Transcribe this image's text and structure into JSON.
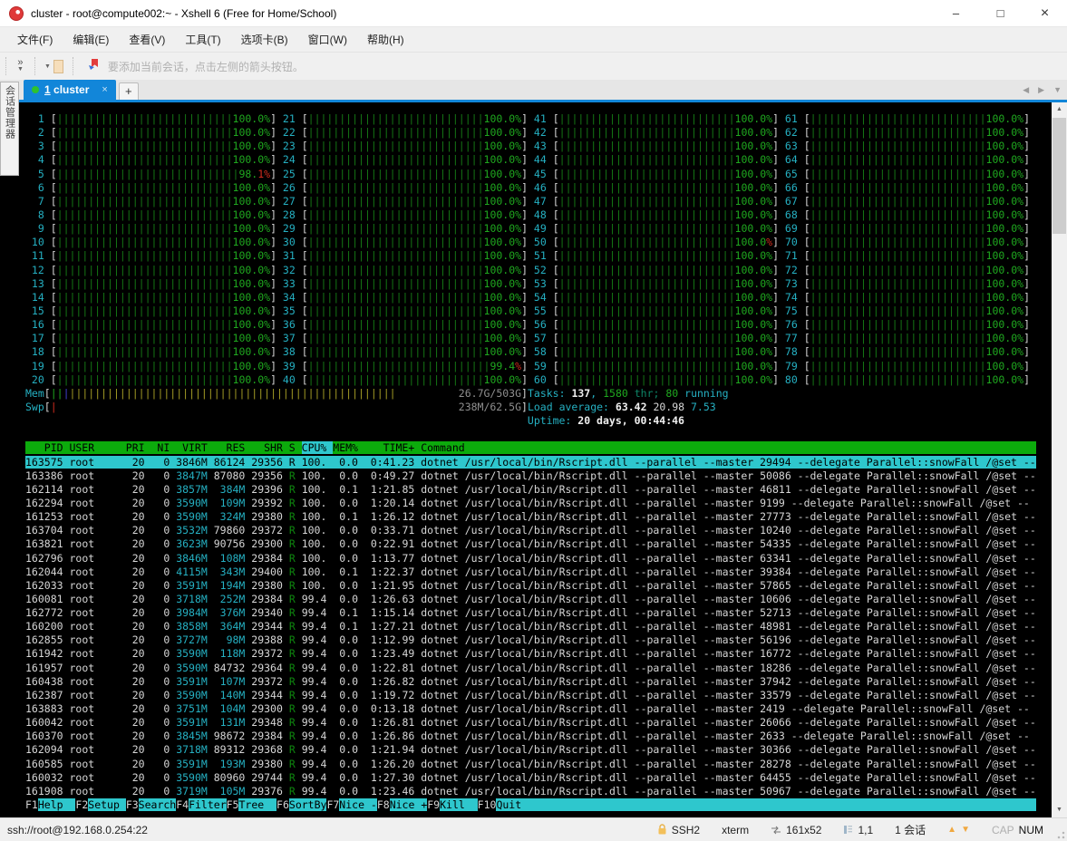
{
  "window": {
    "title": "cluster - root@compute002:~ - Xshell 6 (Free for Home/School)",
    "menu": [
      "文件(F)",
      "编辑(E)",
      "查看(V)",
      "工具(T)",
      "选项卡(B)",
      "窗口(W)",
      "帮助(H)"
    ],
    "toolbar_hint": "要添加当前会话，点击左侧的箭头按钮。",
    "tab": {
      "index": "1",
      "label": "cluster",
      "close": "×",
      "add": "+"
    },
    "side_tab": "会话管理器",
    "controls": {
      "minimize": "–",
      "maximize": "□",
      "close": "×"
    },
    "statusbar": {
      "url": "ssh://root@192.168.0.254:22",
      "protocol": "SSH2",
      "term_type": "xterm",
      "size": "161x52",
      "cursor": "1,1",
      "sessions": "1 会话",
      "cap": "CAP",
      "num": "NUM"
    }
  },
  "htop": {
    "cpus": [
      "100.0%",
      "100.0%",
      "100.0%",
      "100.0%",
      {
        "m": "98.",
        "r": "1%"
      },
      "100.0%",
      "100.0%",
      "100.0%",
      "100.0%",
      "100.0%",
      "100.0%",
      "100.0%",
      "100.0%",
      "100.0%",
      "100.0%",
      "100.0%",
      "100.0%",
      "100.0%",
      "100.0%",
      "100.0%",
      "100.0%",
      "100.0%",
      "100.0%",
      "100.0%",
      "100.0%",
      "100.0%",
      "100.0%",
      "100.0%",
      "100.0%",
      "100.0%",
      "100.0%",
      "100.0%",
      "100.0%",
      "100.0%",
      "100.0%",
      "100.0%",
      "100.0%",
      "100.0%",
      {
        "m": "99.4",
        "r": "%"
      },
      "100.0%",
      "100.0%",
      "100.0%",
      "100.0%",
      "100.0%",
      "100.0%",
      "100.0%",
      "100.0%",
      "100.0%",
      "100.0%",
      {
        "m": "100.0",
        "r": "%"
      },
      "100.0%",
      "100.0%",
      "100.0%",
      "100.0%",
      "100.0%",
      "100.0%",
      "100.0%",
      "100.0%",
      "100.0%",
      "100.0%",
      "100.0%",
      "100.0%",
      "100.0%",
      "100.0%",
      "100.0%",
      "100.0%",
      "100.0%",
      "100.0%",
      "100.0%",
      "100.0%",
      "100.0%",
      "100.0%",
      "100.0%",
      "100.0%",
      "100.0%",
      "100.0%",
      "100.0%",
      "100.0%",
      "100.0%",
      "100.0%"
    ],
    "mem": {
      "label": "Mem",
      "value": "26.7G/503G"
    },
    "swp": {
      "label": "Swp",
      "value": "238M/62.5G"
    },
    "tasks_line": [
      [
        "Tasks: ",
        "cy"
      ],
      [
        "137",
        "whb"
      ],
      [
        ", ",
        "cy"
      ],
      [
        "1580",
        "gr"
      ],
      [
        " thr",
        "thr"
      ],
      [
        "; ",
        "thr"
      ],
      [
        "80",
        "gr"
      ],
      [
        " running",
        "cy"
      ]
    ],
    "load_line": [
      [
        "Load average: ",
        "cy"
      ],
      [
        "63.42 ",
        "whb"
      ],
      [
        "20.98 ",
        "wh"
      ],
      [
        "7.53",
        "cy"
      ]
    ],
    "uptime_line": [
      [
        "Uptime: ",
        "cy"
      ],
      [
        "20 days, 00:44:46",
        "whb"
      ]
    ],
    "columns": [
      "PID",
      "USER",
      "PRI",
      "NI",
      "VIRT",
      "RES",
      "SHR",
      "S",
      "CPU%",
      "MEM%",
      "TIME+",
      "Command"
    ],
    "sort_column": "CPU%",
    "processes": [
      {
        "sel": true,
        "pid": "163575",
        "user": "root",
        "pri": "20",
        "ni": "0",
        "virt": "3846M",
        "res": "86124",
        "shr": "29356",
        "s": "R",
        "cpu": "100.",
        "mem": "0.0",
        "time": "0:41.23",
        "cmd": "dotnet /usr/local/bin/Rscript.dll --parallel --master 29494 --delegate Parallel::snowFall /@set --"
      },
      {
        "pid": "163386",
        "user": "root",
        "pri": "20",
        "ni": "0",
        "virt": "3847M",
        "res": "87080",
        "shr": "29356",
        "s": "R",
        "cpu": "100.",
        "mem": "0.0",
        "time": "0:49.27",
        "cmd": "dotnet /usr/local/bin/Rscript.dll --parallel --master 50086 --delegate Parallel::snowFall /@set --"
      },
      {
        "pid": "162114",
        "user": "root",
        "pri": "20",
        "ni": "0",
        "virt": "3857M",
        "res": "384M",
        "shr": "29396",
        "s": "R",
        "cpu": "100.",
        "mem": "0.1",
        "time": "1:21.85",
        "cmd": "dotnet /usr/local/bin/Rscript.dll --parallel --master 46811 --delegate Parallel::snowFall /@set --"
      },
      {
        "pid": "162294",
        "user": "root",
        "pri": "20",
        "ni": "0",
        "virt": "3590M",
        "res": "109M",
        "shr": "29392",
        "s": "R",
        "cpu": "100.",
        "mem": "0.0",
        "time": "1:20.14",
        "cmd": "dotnet /usr/local/bin/Rscript.dll --parallel --master 9199 --delegate Parallel::snowFall /@set --"
      },
      {
        "pid": "161253",
        "user": "root",
        "pri": "20",
        "ni": "0",
        "virt": "3590M",
        "res": "324M",
        "shr": "29380",
        "s": "R",
        "cpu": "100.",
        "mem": "0.1",
        "time": "1:26.12",
        "cmd": "dotnet /usr/local/bin/Rscript.dll --parallel --master 27773 --delegate Parallel::snowFall /@set --"
      },
      {
        "pid": "163704",
        "user": "root",
        "pri": "20",
        "ni": "0",
        "virt": "3532M",
        "res": "79860",
        "shr": "29372",
        "s": "R",
        "cpu": "100.",
        "mem": "0.0",
        "time": "0:33.71",
        "cmd": "dotnet /usr/local/bin/Rscript.dll --parallel --master 10240 --delegate Parallel::snowFall /@set --"
      },
      {
        "pid": "163821",
        "user": "root",
        "pri": "20",
        "ni": "0",
        "virt": "3623M",
        "res": "90756",
        "shr": "29300",
        "s": "R",
        "cpu": "100.",
        "mem": "0.0",
        "time": "0:22.91",
        "cmd": "dotnet /usr/local/bin/Rscript.dll --parallel --master 54335 --delegate Parallel::snowFall /@set --"
      },
      {
        "pid": "162796",
        "user": "root",
        "pri": "20",
        "ni": "0",
        "virt": "3846M",
        "res": "108M",
        "shr": "29384",
        "s": "R",
        "cpu": "100.",
        "mem": "0.0",
        "time": "1:13.77",
        "cmd": "dotnet /usr/local/bin/Rscript.dll --parallel --master 63341 --delegate Parallel::snowFall /@set --"
      },
      {
        "pid": "162044",
        "user": "root",
        "pri": "20",
        "ni": "0",
        "virt": "4115M",
        "res": "343M",
        "shr": "29400",
        "s": "R",
        "cpu": "100.",
        "mem": "0.1",
        "time": "1:22.37",
        "cmd": "dotnet /usr/local/bin/Rscript.dll --parallel --master 39384 --delegate Parallel::snowFall /@set --"
      },
      {
        "pid": "162033",
        "user": "root",
        "pri": "20",
        "ni": "0",
        "virt": "3591M",
        "res": "194M",
        "shr": "29380",
        "s": "R",
        "cpu": "100.",
        "mem": "0.0",
        "time": "1:21.95",
        "cmd": "dotnet /usr/local/bin/Rscript.dll --parallel --master 57865 --delegate Parallel::snowFall /@set --"
      },
      {
        "pid": "160081",
        "user": "root",
        "pri": "20",
        "ni": "0",
        "virt": "3718M",
        "res": "252M",
        "shr": "29384",
        "s": "R",
        "cpu": "99.4",
        "mem": "0.0",
        "time": "1:26.63",
        "cmd": "dotnet /usr/local/bin/Rscript.dll --parallel --master 10606 --delegate Parallel::snowFall /@set --"
      },
      {
        "pid": "162772",
        "user": "root",
        "pri": "20",
        "ni": "0",
        "virt": "3984M",
        "res": "376M",
        "shr": "29340",
        "s": "R",
        "cpu": "99.4",
        "mem": "0.1",
        "time": "1:15.14",
        "cmd": "dotnet /usr/local/bin/Rscript.dll --parallel --master 52713 --delegate Parallel::snowFall /@set --"
      },
      {
        "pid": "160200",
        "user": "root",
        "pri": "20",
        "ni": "0",
        "virt": "3858M",
        "res": "364M",
        "shr": "29344",
        "s": "R",
        "cpu": "99.4",
        "mem": "0.1",
        "time": "1:27.21",
        "cmd": "dotnet /usr/local/bin/Rscript.dll --parallel --master 48981 --delegate Parallel::snowFall /@set --"
      },
      {
        "pid": "162855",
        "user": "root",
        "pri": "20",
        "ni": "0",
        "virt": "3727M",
        "res": "98M",
        "shr": "29388",
        "s": "R",
        "cpu": "99.4",
        "mem": "0.0",
        "time": "1:12.99",
        "cmd": "dotnet /usr/local/bin/Rscript.dll --parallel --master 56196 --delegate Parallel::snowFall /@set --"
      },
      {
        "pid": "161942",
        "user": "root",
        "pri": "20",
        "ni": "0",
        "virt": "3590M",
        "res": "118M",
        "shr": "29372",
        "s": "R",
        "cpu": "99.4",
        "mem": "0.0",
        "time": "1:23.49",
        "cmd": "dotnet /usr/local/bin/Rscript.dll --parallel --master 16772 --delegate Parallel::snowFall /@set --"
      },
      {
        "pid": "161957",
        "user": "root",
        "pri": "20",
        "ni": "0",
        "virt": "3590M",
        "res": "84732",
        "shr": "29364",
        "s": "R",
        "cpu": "99.4",
        "mem": "0.0",
        "time": "1:22.81",
        "cmd": "dotnet /usr/local/bin/Rscript.dll --parallel --master 18286 --delegate Parallel::snowFall /@set --"
      },
      {
        "pid": "160438",
        "user": "root",
        "pri": "20",
        "ni": "0",
        "virt": "3591M",
        "res": "107M",
        "shr": "29372",
        "s": "R",
        "cpu": "99.4",
        "mem": "0.0",
        "time": "1:26.82",
        "cmd": "dotnet /usr/local/bin/Rscript.dll --parallel --master 37942 --delegate Parallel::snowFall /@set --"
      },
      {
        "pid": "162387",
        "user": "root",
        "pri": "20",
        "ni": "0",
        "virt": "3590M",
        "res": "140M",
        "shr": "29344",
        "s": "R",
        "cpu": "99.4",
        "mem": "0.0",
        "time": "1:19.72",
        "cmd": "dotnet /usr/local/bin/Rscript.dll --parallel --master 33579 --delegate Parallel::snowFall /@set --"
      },
      {
        "pid": "163883",
        "user": "root",
        "pri": "20",
        "ni": "0",
        "virt": "3751M",
        "res": "104M",
        "shr": "29300",
        "s": "R",
        "cpu": "99.4",
        "mem": "0.0",
        "time": "0:13.18",
        "cmd": "dotnet /usr/local/bin/Rscript.dll --parallel --master 2419 --delegate Parallel::snowFall /@set --"
      },
      {
        "pid": "160042",
        "user": "root",
        "pri": "20",
        "ni": "0",
        "virt": "3591M",
        "res": "131M",
        "shr": "29348",
        "s": "R",
        "cpu": "99.4",
        "mem": "0.0",
        "time": "1:26.81",
        "cmd": "dotnet /usr/local/bin/Rscript.dll --parallel --master 26066 --delegate Parallel::snowFall /@set --"
      },
      {
        "pid": "160370",
        "user": "root",
        "pri": "20",
        "ni": "0",
        "virt": "3845M",
        "res": "98672",
        "shr": "29384",
        "s": "R",
        "cpu": "99.4",
        "mem": "0.0",
        "time": "1:26.86",
        "cmd": "dotnet /usr/local/bin/Rscript.dll --parallel --master 2633 --delegate Parallel::snowFall /@set --"
      },
      {
        "pid": "162094",
        "user": "root",
        "pri": "20",
        "ni": "0",
        "virt": "3718M",
        "res": "89312",
        "shr": "29368",
        "s": "R",
        "cpu": "99.4",
        "mem": "0.0",
        "time": "1:21.94",
        "cmd": "dotnet /usr/local/bin/Rscript.dll --parallel --master 30366 --delegate Parallel::snowFall /@set --"
      },
      {
        "pid": "160585",
        "user": "root",
        "pri": "20",
        "ni": "0",
        "virt": "3591M",
        "res": "193M",
        "shr": "29380",
        "s": "R",
        "cpu": "99.4",
        "mem": "0.0",
        "time": "1:26.20",
        "cmd": "dotnet /usr/local/bin/Rscript.dll --parallel --master 28278 --delegate Parallel::snowFall /@set --"
      },
      {
        "pid": "160032",
        "user": "root",
        "pri": "20",
        "ni": "0",
        "virt": "3590M",
        "res": "80960",
        "shr": "29744",
        "s": "R",
        "cpu": "99.4",
        "mem": "0.0",
        "time": "1:27.30",
        "cmd": "dotnet /usr/local/bin/Rscript.dll --parallel --master 64455 --delegate Parallel::snowFall /@set --"
      },
      {
        "pid": "161908",
        "user": "root",
        "pri": "20",
        "ni": "0",
        "virt": "3719M",
        "res": "105M",
        "shr": "29376",
        "s": "R",
        "cpu": "99.4",
        "mem": "0.0",
        "time": "1:23.46",
        "cmd": "dotnet /usr/local/bin/Rscript.dll --parallel --master 50967 --delegate Parallel::snowFall /@set --"
      }
    ],
    "fkeys": [
      [
        "F1",
        "Help"
      ],
      [
        "F2",
        "Setup"
      ],
      [
        "F3",
        "Search"
      ],
      [
        "F4",
        "Filter"
      ],
      [
        "F5",
        "Tree"
      ],
      [
        "F6",
        "SortBy"
      ],
      [
        "F7",
        "Nice -"
      ],
      [
        "F8",
        "Nice +"
      ],
      [
        "F9",
        "Kill"
      ],
      [
        "F10",
        "Quit"
      ]
    ]
  }
}
